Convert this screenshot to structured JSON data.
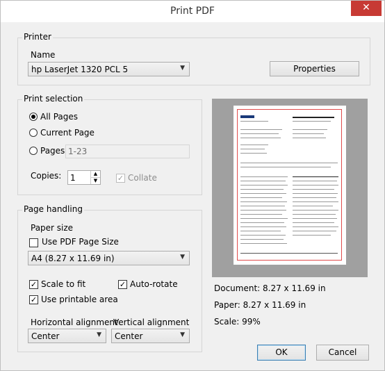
{
  "window": {
    "title": "Print PDF",
    "close_glyph": "✕"
  },
  "printer": {
    "legend": "Printer",
    "name_label": "Name",
    "name_value": "hp LaserJet 1320 PCL 5",
    "properties_button": "Properties"
  },
  "print_selection": {
    "legend": "Print selection",
    "all_pages": "All Pages",
    "current_page": "Current Page",
    "pages": "Pages",
    "pages_value": "1-23",
    "selected": "all_pages",
    "copies_label": "Copies:",
    "copies_value": "1",
    "collate": "Collate",
    "collate_checked": true
  },
  "page_handling": {
    "legend": "Page handling",
    "paper_size_label": "Paper size",
    "use_pdf_page_size": "Use PDF Page Size",
    "use_pdf_page_size_checked": false,
    "paper_size_value": "A4 (8.27 x 11.69 in)",
    "scale_to_fit": "Scale to fit",
    "scale_to_fit_checked": true,
    "auto_rotate": "Auto-rotate",
    "auto_rotate_checked": true,
    "use_printable_area": "Use printable area",
    "use_printable_area_checked": true,
    "horizontal_alignment_label": "Horizontal alignment",
    "horizontal_alignment_value": "Center",
    "vertical_alignment_label": "Vertical alignment",
    "vertical_alignment_value": "Center"
  },
  "preview": {
    "document_size": "Document: 8.27 x 11.69 in",
    "paper_size": "Paper: 8.27 x 11.69 in",
    "scale": "Scale: 99%"
  },
  "buttons": {
    "ok": "OK",
    "cancel": "Cancel"
  },
  "colors": {
    "close_button": "#c73a34",
    "margin_line": "#e04a4a",
    "preview_bg": "#a0a0a0"
  }
}
